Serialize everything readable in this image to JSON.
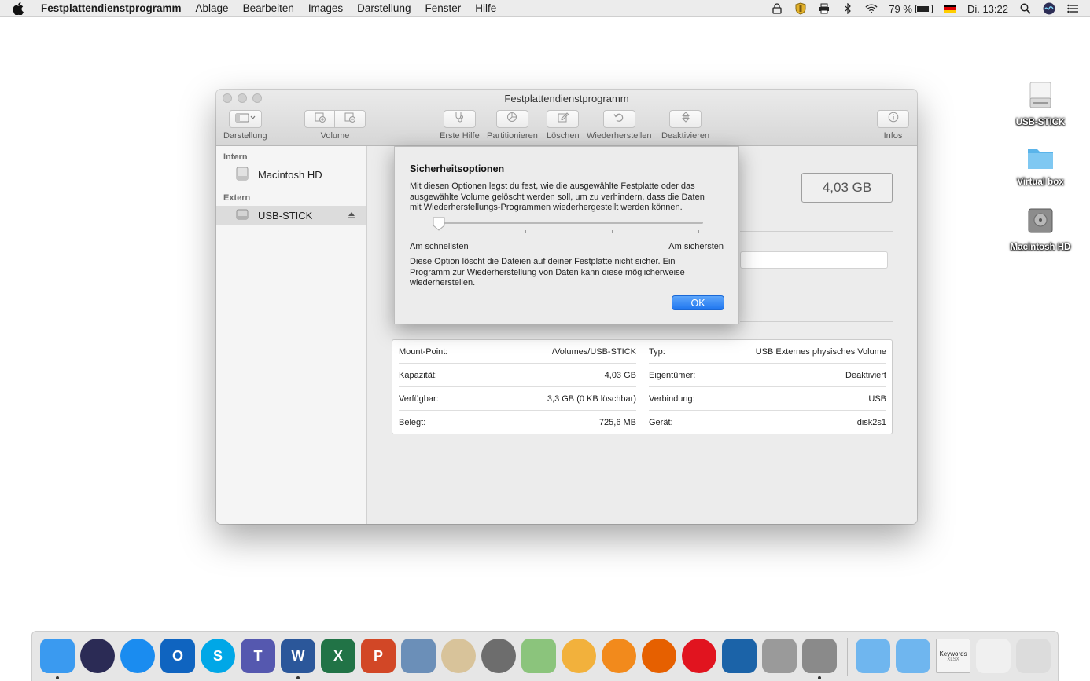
{
  "menubar": {
    "app_name": "Festplattendienstprogramm",
    "items": [
      "Ablage",
      "Bearbeiten",
      "Images",
      "Darstellung",
      "Fenster",
      "Hilfe"
    ],
    "battery": "79 %",
    "clock": "Di. 13:22"
  },
  "desktop": {
    "icons": [
      {
        "label": "USB-STICK",
        "icon": "external-drive-icon"
      },
      {
        "label": "Virtual box",
        "icon": "folder-icon"
      },
      {
        "label": "Macintosh HD",
        "icon": "hard-drive-icon"
      }
    ]
  },
  "window": {
    "title": "Festplattendienstprogramm",
    "toolbar": {
      "view_label": "Darstellung",
      "volume_label": "Volume",
      "first_aid_label": "Erste Hilfe",
      "partition_label": "Partitionieren",
      "erase_label": "Löschen",
      "restore_label": "Wiederherstellen",
      "unmount_label": "Deaktivieren",
      "info_label": "Infos"
    },
    "sidebar": {
      "internal_header": "Intern",
      "internal_items": [
        "Macintosh HD"
      ],
      "external_header": "Extern",
      "external_items": [
        "USB-STICK"
      ]
    },
    "capacity_badge": "4,03 GB",
    "info": {
      "left": [
        {
          "label": "Mount-Point:",
          "value": "/Volumes/USB-STICK"
        },
        {
          "label": "Kapazität:",
          "value": "4,03 GB"
        },
        {
          "label": "Verfügbar:",
          "value": "3,3 GB (0 KB löschbar)"
        },
        {
          "label": "Belegt:",
          "value": "725,6 MB"
        }
      ],
      "right": [
        {
          "label": "Typ:",
          "value": "USB Externes physisches Volume"
        },
        {
          "label": "Eigentümer:",
          "value": "Deaktiviert"
        },
        {
          "label": "Verbindung:",
          "value": "USB"
        },
        {
          "label": "Gerät:",
          "value": "disk2s1"
        }
      ]
    }
  },
  "dialog": {
    "title": "Sicherheitsoptionen",
    "intro_lines": [
      "Mit diesen Optionen legst du fest, wie die ausgewählte Festplatte oder das",
      "ausgewählte Volume gelöscht werden soll, um zu verhindern, dass die Daten",
      "mit Wiederherstellungs-Programmen wiederhergestellt werden können."
    ],
    "slider_min_label": "Am schnellsten",
    "slider_max_label": "Am sichersten",
    "slider_level": 0,
    "description_lines": [
      "Diese Option löscht die Dateien auf deiner Festplatte nicht sicher. Ein",
      "Programm zur Wiederherstellung von Daten kann diese möglicherweise",
      "wiederherstellen."
    ],
    "ok_label": "OK"
  },
  "dock": {
    "apps": [
      {
        "name": "finder-icon",
        "color": "#3a9af0"
      },
      {
        "name": "siri-icon",
        "color": "#2b2b55"
      },
      {
        "name": "safari-icon",
        "color": "#1a8cf0"
      },
      {
        "name": "outlook-icon",
        "color": "#0f64c0",
        "text": "O"
      },
      {
        "name": "skype-icon",
        "color": "#00a7e7",
        "text": "S"
      },
      {
        "name": "teams-icon",
        "color": "#5558af",
        "text": "T"
      },
      {
        "name": "word-icon",
        "color": "#2b579a",
        "text": "W"
      },
      {
        "name": "excel-icon",
        "color": "#217346",
        "text": "X"
      },
      {
        "name": "powerpoint-icon",
        "color": "#d24726",
        "text": "P"
      },
      {
        "name": "preview-icon",
        "color": "#6b8fb8"
      },
      {
        "name": "ornament-app-icon",
        "color": "#d8c39a"
      },
      {
        "name": "system-preferences-icon",
        "color": "#6d6d6d"
      },
      {
        "name": "maps-icon",
        "color": "#8bc47c"
      },
      {
        "name": "photos-icon",
        "color": "#f2b13c"
      },
      {
        "name": "ibooks-icon",
        "color": "#f28a1c"
      },
      {
        "name": "firefox-icon",
        "color": "#e66000"
      },
      {
        "name": "opera-icon",
        "color": "#e1141f"
      },
      {
        "name": "virtualbox-icon",
        "color": "#1b63a8"
      },
      {
        "name": "scissors-app-icon",
        "color": "#9a9a9a"
      },
      {
        "name": "disk-utility-icon",
        "color": "#8a8a8a"
      },
      {
        "name": "applications-folder-icon",
        "color": "#6fb6ef"
      },
      {
        "name": "documents-folder-icon",
        "color": "#6fb6ef"
      },
      {
        "name": "keywords-xlsx-icon",
        "color": "#f4f4f4",
        "text": "Keywords",
        "subtext": "XLSX"
      },
      {
        "name": "screenshot-file-icon",
        "color": "#f0f0f0"
      },
      {
        "name": "trash-icon",
        "color": "#dcdcdc"
      }
    ]
  }
}
